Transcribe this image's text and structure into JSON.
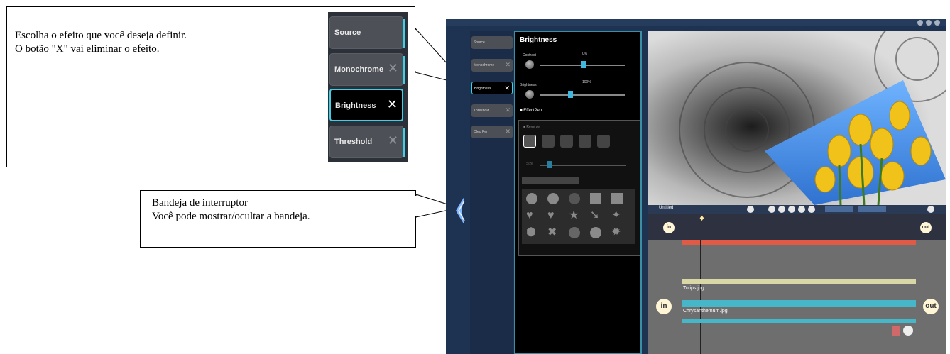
{
  "callouts": {
    "effect_select": {
      "line1": "Escolha o efeito que você deseja definir.",
      "line2": "O botão \"X\" vai eliminar o efeito."
    },
    "tray_switch": {
      "line1": "Bandeja de interruptor",
      "line2": "Você pode mostrar/ocultar a bandeja."
    }
  },
  "zoom_effect_list": {
    "items": [
      {
        "label": "Source",
        "has_close": false,
        "selected": false
      },
      {
        "label": "Monochrome",
        "has_close": true,
        "selected": false
      },
      {
        "label": "Brightness",
        "has_close": true,
        "selected": true
      },
      {
        "label": "Threshold",
        "has_close": true,
        "selected": false
      }
    ],
    "close_glyph": "✕"
  },
  "app": {
    "tray_items": [
      {
        "label": "Source"
      },
      {
        "label": "Monochrome"
      },
      {
        "label": "Brightness"
      },
      {
        "label": "Threshold"
      },
      {
        "label": "Oleo Pen"
      }
    ],
    "effect_panel": {
      "title": "Brightness",
      "contrast_label": "Contrast",
      "contrast_value": "0%",
      "brightness_label": "Brightness",
      "brightness_value": "100%",
      "effectpen_label": "EffectPen",
      "reverse_label": "Reverse",
      "size_label": "Size"
    },
    "timeline": {
      "title": "Untitled",
      "clips": [
        {
          "label": "Tulips.jpg",
          "color": "#d9d7a6"
        },
        {
          "label": "Chrysanthemum.jpg",
          "color": "#45b7c9"
        }
      ],
      "red_track_color": "#e05a45",
      "in_label": "in",
      "out_label": "out"
    }
  },
  "colors": {
    "accent": "#3fd0e8",
    "app_bg": "#1e3352"
  }
}
